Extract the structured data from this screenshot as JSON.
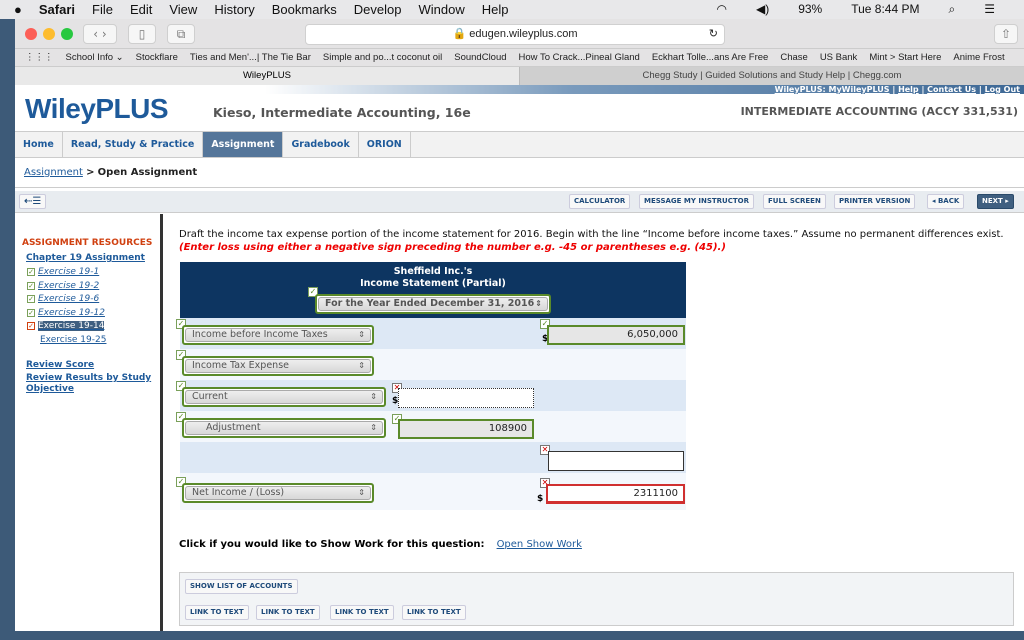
{
  "menubar": {
    "apple": "",
    "items": [
      "Safari",
      "File",
      "Edit",
      "View",
      "History",
      "Bookmarks",
      "Develop",
      "Window",
      "Help"
    ],
    "battery": "93%",
    "clock": "Tue 8:44 PM"
  },
  "browser": {
    "url": "edugen.wileyplus.com",
    "bookmarks": [
      "School Info ⌄",
      "Stockflare",
      "Ties and Men'...| The Tie Bar",
      "Simple and po...t coconut oil",
      "SoundCloud",
      "How To Crack...Pineal Gland",
      "Eckhart Tolle...ans Are Free",
      "Chase",
      "US Bank",
      "Mint > Start Here",
      "Anime Frost"
    ],
    "tabs": [
      "WileyPLUS",
      "Chegg Study | Guided Solutions and Study Help | Chegg.com"
    ]
  },
  "header": {
    "toplinks": [
      "WileyPLUS: MyWileyPLUS",
      "Help",
      "Contact Us",
      "Log Out"
    ],
    "logo": "WileyPLUS",
    "book": "Kieso, Intermediate Accounting, 16e",
    "course": "INTERMEDIATE ACCOUNTING (ACCY 331,531)"
  },
  "nav": [
    "Home",
    "Read, Study & Practice",
    "Assignment",
    "Gradebook",
    "ORION"
  ],
  "breadcrumb": {
    "link": "Assignment",
    "sep": ">",
    "current": "Open Assignment"
  },
  "tools": {
    "calculator": "CALCULATOR",
    "message": "MESSAGE MY INSTRUCTOR",
    "fullscreen": "FULL SCREEN",
    "printer": "PRINTER VERSION",
    "back": "◂ BACK",
    "next": "NEXT ▸"
  },
  "sidebar": {
    "title": "ASSIGNMENT RESOURCES",
    "chapter": "Chapter 19 Assignment",
    "exercises": [
      "Exercise 19-1",
      "Exercise 19-2",
      "Exercise 19-6",
      "Exercise 19-12",
      "Exercise 19-14",
      "Exercise 19-25"
    ],
    "review_score": "Review Score",
    "review_results": "Review Results by Study Objective"
  },
  "question": {
    "text": "Draft the income tax expense portion of the income statement for 2016. Begin with the line “Income before income taxes.” Assume no permanent differences exist. ",
    "emphasis": "(Enter loss using either a negative sign preceding the number e.g. -45 or parentheses e.g. (45).)"
  },
  "statement": {
    "company": "Sheffield Inc.'s",
    "title": "Income Statement (Partial)",
    "period": "For the Year Ended December 31, 2016",
    "rows": [
      {
        "label": "Income before Income Taxes",
        "amount": "6,050,000"
      },
      {
        "label": "Income Tax Expense"
      },
      {
        "label": "Current",
        "amount": ""
      },
      {
        "label": "Adjustment",
        "amount": "108900"
      },
      {
        "total": ""
      },
      {
        "label": "Net Income / (Loss)",
        "amount": "2311100"
      }
    ],
    "currency": "$"
  },
  "showwork": {
    "prompt": "Click if you would like to Show Work for this question:",
    "link": "Open Show Work"
  },
  "bottom": {
    "show_accounts": "SHOW LIST OF ACCOUNTS",
    "links": [
      "LINK TO TEXT",
      "LINK TO TEXT",
      "LINK TO TEXT",
      "LINK TO TEXT"
    ]
  }
}
